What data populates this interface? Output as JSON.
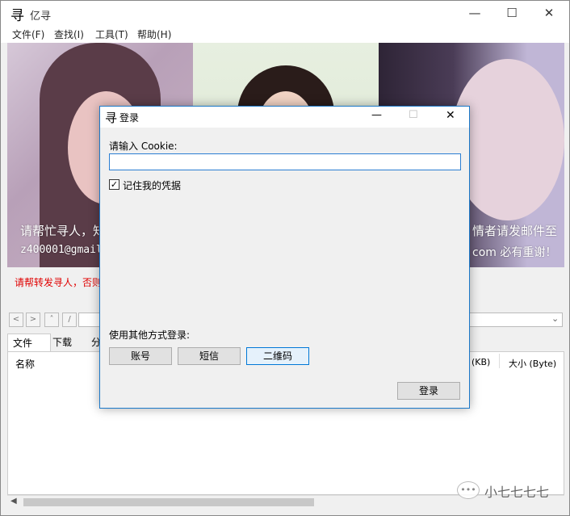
{
  "app": {
    "title": "亿寻",
    "logo_glyph": "寻"
  },
  "menu": [
    "文件(F)",
    "查找(I)",
    "工具(T)",
    "帮助(H)"
  ],
  "window_controls": {
    "minimize": "—",
    "maximize": "☐",
    "close": "✕"
  },
  "banner": {
    "left_line1": "请帮忙寻人，知",
    "left_line2": "z400001@gmail.",
    "right_line1": "情者请发邮件至",
    "right_line2": "com 必有重谢！"
  },
  "red_notice": "请帮转发寻人，否则",
  "nav": {
    "back": "<",
    "forward": ">",
    "up": "˄",
    "slash": "/"
  },
  "tabs": [
    "文件",
    "下载",
    "分"
  ],
  "columns": {
    "name": "名称",
    "size_kb": "(KB)",
    "size_byte": "大小 (Byte)"
  },
  "dialog": {
    "title": "登录",
    "cookie_label": "请输入 Cookie:",
    "cookie_value": "",
    "remember_label": "记住我的凭据",
    "remember_checked": true,
    "checkmark": "✓",
    "other_methods_label": "使用其他方式登录:",
    "method_buttons": [
      "账号",
      "短信",
      "二维码"
    ],
    "login_button": "登录"
  },
  "watermark": "小七七七七",
  "colors": {
    "accent": "#1b78c8",
    "arrow": "#e8302a",
    "notice": "#e00000"
  }
}
